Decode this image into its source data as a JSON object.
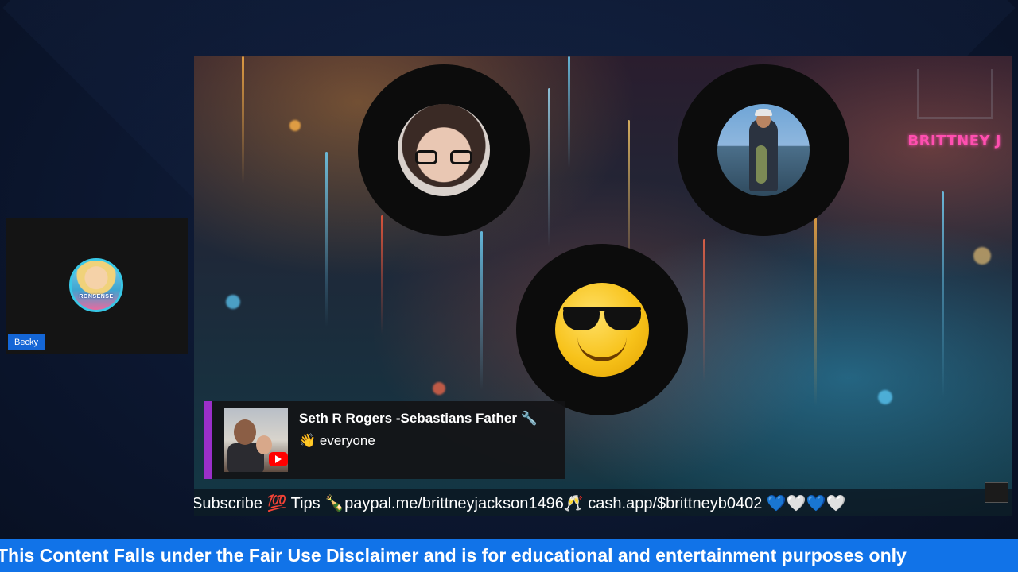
{
  "side_guest": {
    "name_tag": "Becky",
    "avatar_icon": "guest-avatar-icon",
    "avatar_caption": "RONSENSE"
  },
  "stage": {
    "host_logo": "BRITTNEY J",
    "participants": [
      {
        "avatar_icon": "woman-with-glasses-avatar"
      },
      {
        "avatar_icon": "man-holding-fish-avatar"
      },
      {
        "avatar_icon": "sunglasses-emoji-avatar"
      }
    ]
  },
  "comment": {
    "author": "Seth R Rogers -Sebastians Father 🔧",
    "message": "👋 everyone",
    "badge_icon": "youtube-icon",
    "accent_color": "#9b2fc9"
  },
  "ticker": {
    "text": "Subscribe 💯 Tips 🍾paypal.me/brittneyjackson1496🥂 cash.app/$brittneyb0402 💙🤍💙🤍"
  },
  "disclaimer": {
    "text": "This Content Falls under the Fair Use Disclaimer and is for educational and entertainment purposes only",
    "color": "#1173e8"
  }
}
